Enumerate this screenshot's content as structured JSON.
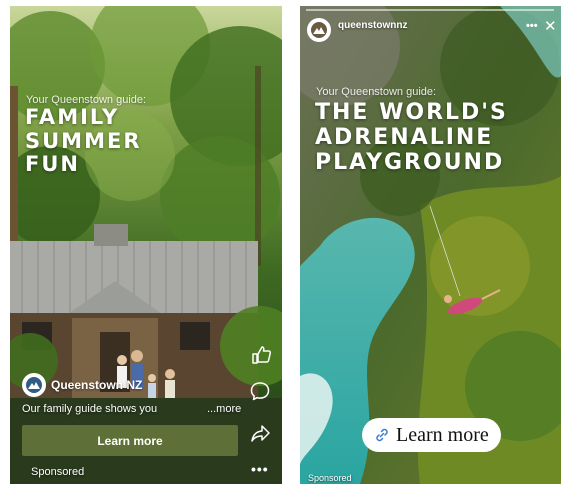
{
  "left_ad": {
    "guide_kicker": "Your Queenstown guide:",
    "headline": [
      "FAMILY",
      "SUMMER",
      "FUN"
    ],
    "brand_name": "Queenstown NZ",
    "caption": "Our family guide shows you",
    "more_label": "...more",
    "cta_label": "Learn more",
    "sponsored": "Sponsored",
    "cta_color": "#5e6f37",
    "icons": [
      "like-icon",
      "comment-icon",
      "share-icon",
      "more-options-icon"
    ]
  },
  "right_ad": {
    "brand_handle": "queenstownnz",
    "guide_kicker": "Your Queenstown guide:",
    "headline": [
      "THE WORLD'S",
      "ADRENALINE",
      "PLAYGROUND"
    ],
    "cta_label": "Learn more",
    "sponsored": "Sponsored",
    "icons": [
      "link-icon",
      "more-options-icon",
      "close-icon"
    ]
  }
}
